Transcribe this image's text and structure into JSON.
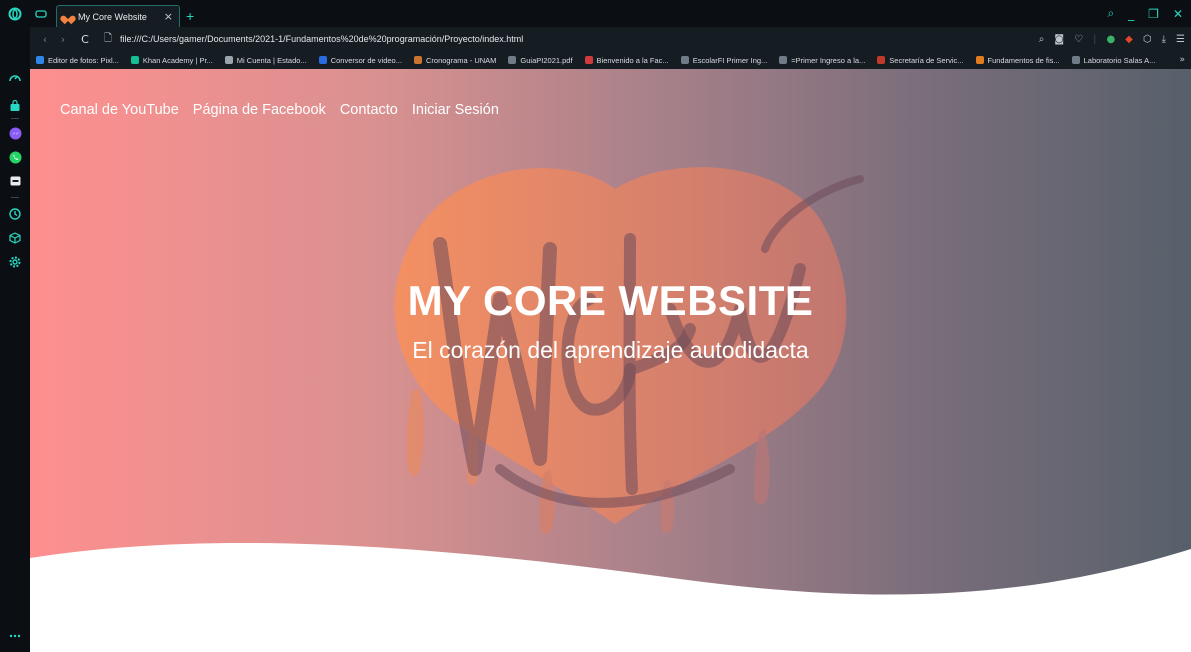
{
  "browser": {
    "tab": {
      "title": "My Core Website",
      "close": "×",
      "new_tab": "+"
    },
    "window_controls": {
      "search": "⌕",
      "minimize": "_",
      "snap": "❐",
      "close": "✕"
    },
    "address_bar": {
      "back": "‹",
      "forward": "›",
      "reload": "C",
      "page_icon": "🗋",
      "url": "file:///C:/Users/gamer/Documents/2021-1/Fundamentos%20de%20programación/Proyecto/index.html"
    },
    "bookmarks": [
      {
        "label": "Editor de fotos: Pixl...",
        "color": "#2f86e8"
      },
      {
        "label": "Khan Academy | Pr...",
        "color": "#14bf96"
      },
      {
        "label": "Mi Cuenta | Estado...",
        "color": "#9aa4ad"
      },
      {
        "label": "Conversor de video...",
        "color": "#2b6be0"
      },
      {
        "label": "Cronograma - UNAM",
        "color": "#c9732e"
      },
      {
        "label": "GuiaPI2021.pdf",
        "color": "#6f7b86"
      },
      {
        "label": "Bienvenido a la Fac...",
        "color": "#d23b3b"
      },
      {
        "label": "EscolarFI Primer Ing...",
        "color": "#6f7b86"
      },
      {
        "label": "=Primer Ingreso a la...",
        "color": "#6f7b86"
      },
      {
        "label": "Secretaría de Servic...",
        "color": "#c0392b"
      },
      {
        "label": "Fundamentos de fis...",
        "color": "#e07b1e"
      },
      {
        "label": "Laboratorio Salas A...",
        "color": "#6f7b86"
      }
    ],
    "bookmarks_more": "»"
  },
  "page": {
    "nav": {
      "youtube": "Canal de YouTube",
      "facebook": "Página de Facebook",
      "contact": "Contacto",
      "login": "Iniciar Sesión"
    },
    "hero_title": "MY CORE WEBSITE",
    "hero_subtitle": "El corazón del aprendizaje autodidacta"
  },
  "colors": {
    "accent": "#28d7c0",
    "hero_gradient_start": "#fe8f8f",
    "hero_gradient_end": "#56606a",
    "heart": "#f08a4b"
  }
}
